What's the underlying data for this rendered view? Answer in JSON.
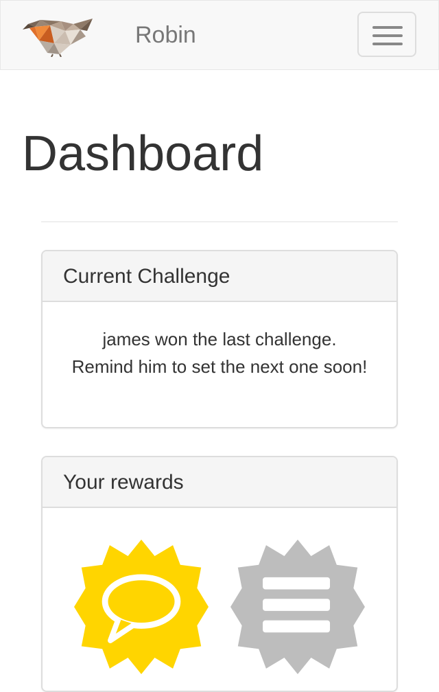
{
  "navbar": {
    "brand": "Robin",
    "logo_icon": "robin-bird-logo",
    "menu_icon": "hamburger-menu-icon"
  },
  "page": {
    "title": "Dashboard"
  },
  "current_challenge": {
    "heading": "Current Challenge",
    "message": "james won the last challenge. Remind him to set the next one soon!"
  },
  "rewards": {
    "heading": "Your rewards",
    "badges": [
      {
        "icon": "speech-bubble-badge-icon",
        "color": "#FFD500",
        "earned": true
      },
      {
        "icon": "list-badge-icon",
        "color": "#BDBDBD",
        "earned": false
      }
    ]
  },
  "colors": {
    "navbar_bg": "#f8f8f8",
    "brand_text": "#777777",
    "badge_earned": "#FFD500",
    "badge_locked": "#BDBDBD"
  }
}
